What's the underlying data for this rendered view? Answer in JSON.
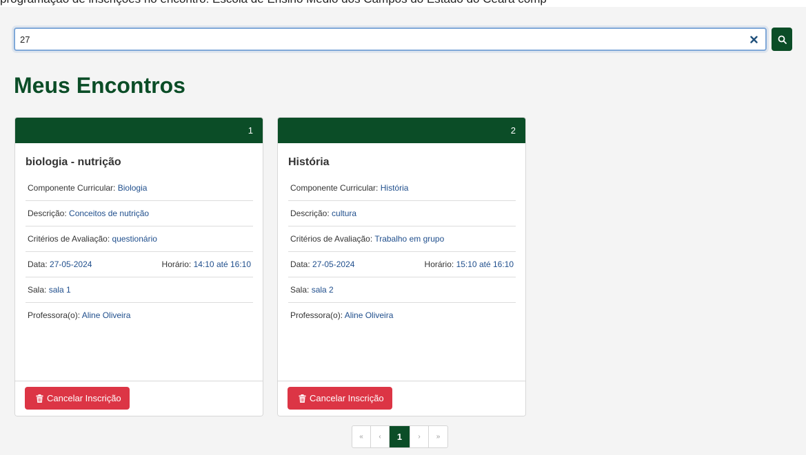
{
  "top_strip_text": "programação de inscrições no encontro: Escola de Ensino Médio dos Campos do Estado do Ceará comp",
  "search": {
    "value": "27",
    "placeholder": ""
  },
  "page_title": "Meus Encontros",
  "cards": [
    {
      "number": "1",
      "title": "biologia - nutrição",
      "component_label": "Componente Curricular:",
      "component_value": "Biologia",
      "description_label": "Descrição:",
      "description_value": "Conceitos de nutrição",
      "criteria_label": "Critérios de Avaliação:",
      "criteria_value": "questionário",
      "date_label": "Data:",
      "date_value": "27-05-2024",
      "time_label": "Horário:",
      "time_start": "14:10",
      "time_sep": "até",
      "time_end": "16:10",
      "room_label": "Sala:",
      "room_value": "sala 1",
      "teacher_label": "Professora(o):",
      "teacher_value": "Aline Oliveira",
      "cancel_label": "Cancelar Inscrição"
    },
    {
      "number": "2",
      "title": "História",
      "component_label": "Componente Curricular:",
      "component_value": "História",
      "description_label": "Descrição:",
      "description_value": "cultura",
      "criteria_label": "Critérios de Avaliação:",
      "criteria_value": "Trabalho em grupo",
      "date_label": "Data:",
      "date_value": "27-05-2024",
      "time_label": "Horário:",
      "time_start": "15:10",
      "time_sep": "até",
      "time_end": "16:10",
      "room_label": "Sala:",
      "room_value": "sala 2",
      "teacher_label": "Professora(o):",
      "teacher_value": "Aline Oliveira",
      "cancel_label": "Cancelar Inscrição"
    }
  ],
  "pagination": {
    "first": "«",
    "prev": "‹",
    "current": "1",
    "next": "›",
    "last": "»"
  },
  "colors": {
    "primary": "#0b4d27",
    "danger": "#dc3545",
    "link": "#1f4e8c",
    "background": "#f4f4f4"
  },
  "icons": {
    "clear": "close-icon",
    "search": "search-icon",
    "cancel": "trash-icon"
  }
}
